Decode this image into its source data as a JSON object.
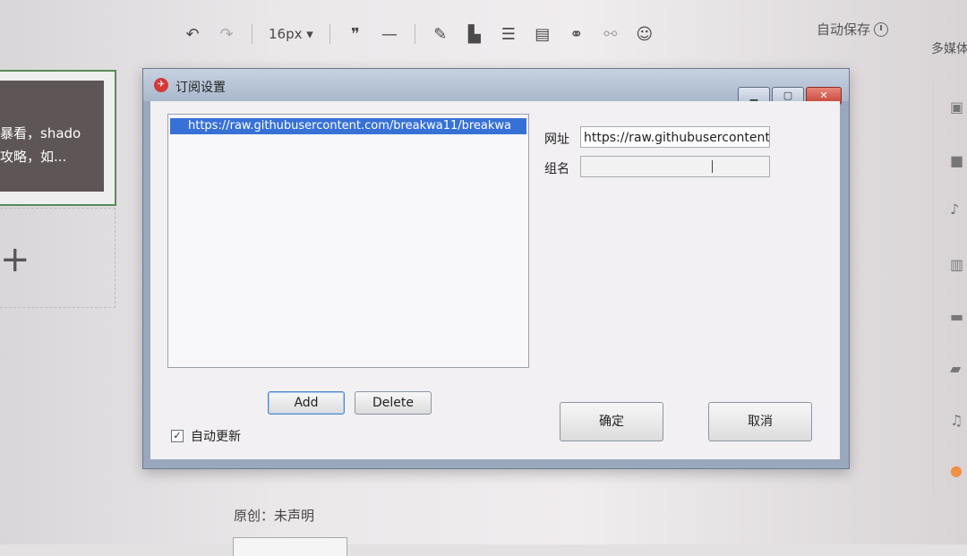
{
  "editor": {
    "toolbar": {
      "undo_icon": "undo-icon",
      "redo_icon": "redo-icon",
      "font_size": "16px",
      "quote_glyph": "❞",
      "hr_glyph": "—",
      "autosave_label": "自动保存"
    },
    "right_panel_label": "多媒体",
    "article": {
      "snippet_line1": "暴看，shado",
      "snippet_line2": "攻略，如..."
    },
    "original_label": "原创：未声明"
  },
  "dialog": {
    "title": "订阅设置",
    "window_buttons": {
      "minimize": "▁",
      "maximize": "▢",
      "close": "✕"
    },
    "list_items": [
      "https://raw.githubusercontent.com/breakwa11/breakwa"
    ],
    "add_label": "Add",
    "delete_label": "Delete",
    "auto_update_label": "自动更新",
    "auto_update_checked": "✓",
    "url_label": "网址",
    "url_value": "https://raw.githubusercontent.c",
    "group_label": "组名",
    "group_value": "",
    "ok_label": "确定",
    "cancel_label": "取消"
  }
}
